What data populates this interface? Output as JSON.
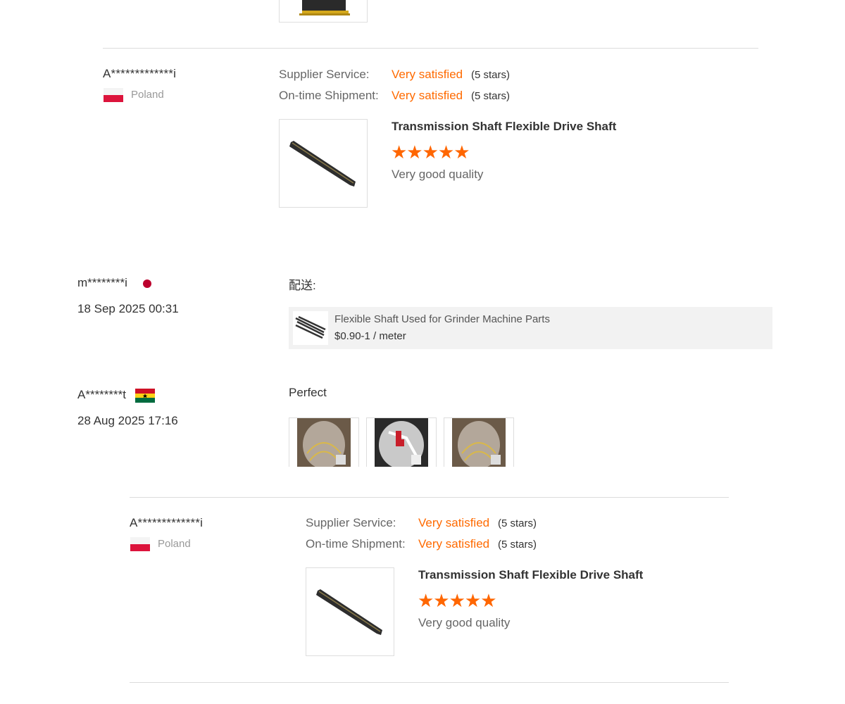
{
  "colors": {
    "accent": "#ff6a00",
    "star": "#ff6600"
  },
  "top_review": {
    "username": "A*************i",
    "country": "Poland",
    "supplier_service_label": "Supplier Service:",
    "supplier_service_value": "Very satisfied",
    "supplier_service_stars": "(5 stars)",
    "shipment_label": "On-time Shipment:",
    "shipment_value": "Very satisfied",
    "shipment_stars": "(5 stars)",
    "product_title": "Transmission Shaft Flexible Drive Shaft",
    "rating": 5,
    "stars": "★★★★★",
    "comment": "Very good quality"
  },
  "middle_reviews": [
    {
      "username": "m********i",
      "date": "18 Sep 2025 00:31",
      "text": "配送:",
      "product": {
        "name": "Flexible Shaft Used for Grinder Machine Parts",
        "price": "$0.90-1 / meter"
      }
    },
    {
      "username": "A********t",
      "date": "28 Aug 2025 17:16",
      "text": "Perfect"
    }
  ],
  "bottom_review": {
    "username": "A*************i",
    "country": "Poland",
    "supplier_service_label": "Supplier Service:",
    "supplier_service_value": "Very satisfied",
    "supplier_service_stars": "(5 stars)",
    "shipment_label": "On-time Shipment:",
    "shipment_value": "Very satisfied",
    "shipment_stars": "(5 stars)",
    "product_title": "Transmission Shaft Flexible Drive Shaft",
    "rating": 5,
    "stars": "★★★★★",
    "comment": "Very good quality"
  }
}
